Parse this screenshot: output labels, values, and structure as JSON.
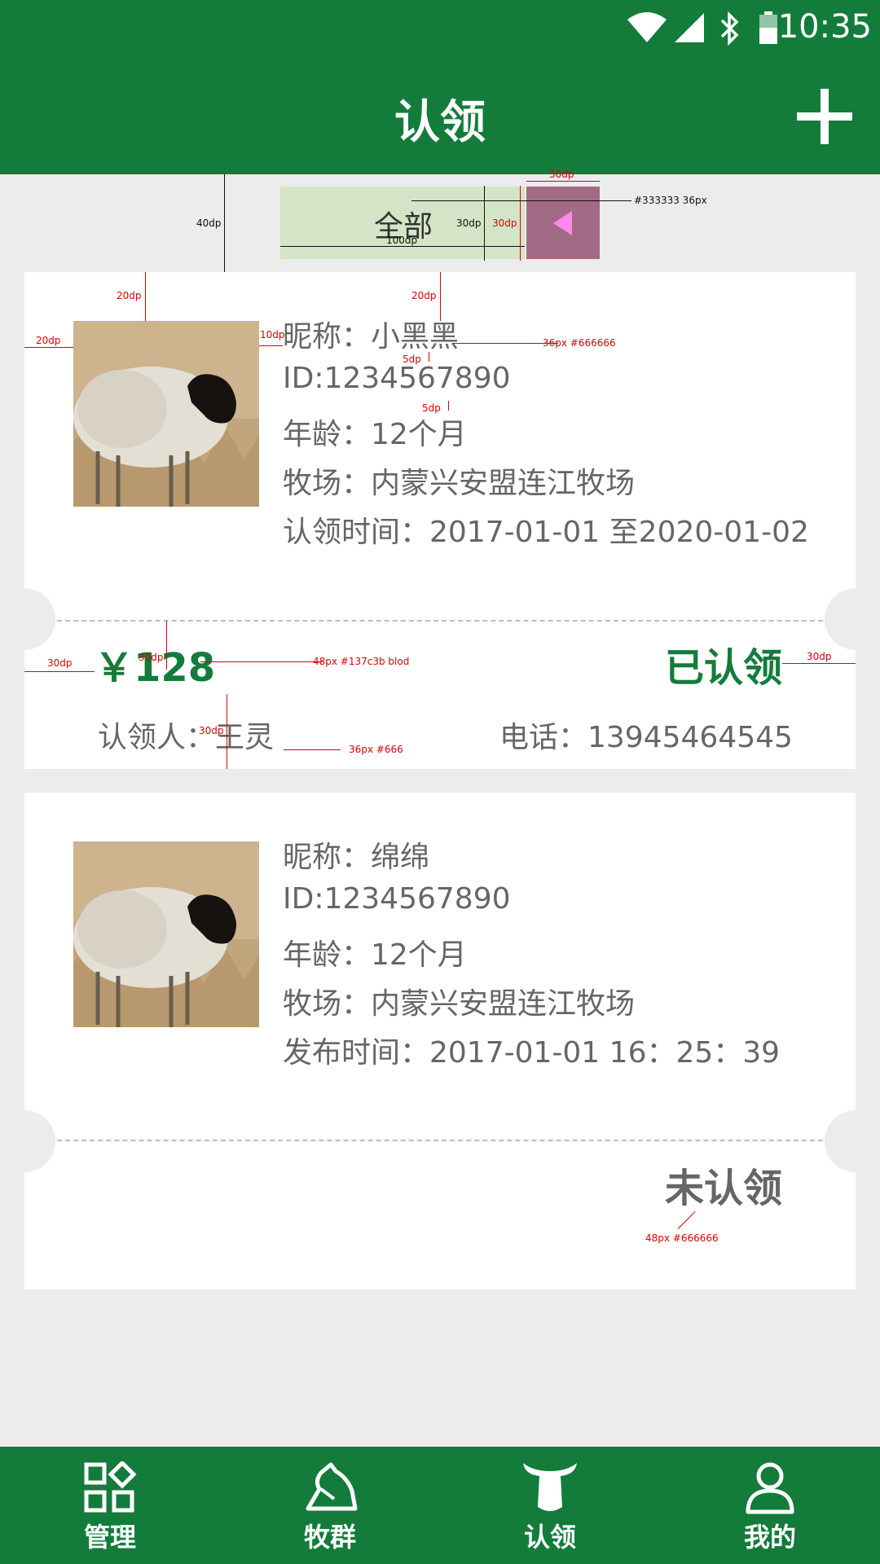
{
  "status_bar": {
    "time": "10:35"
  },
  "header": {
    "title": "认领",
    "add_label": "+"
  },
  "filter": {
    "label": "全部"
  },
  "annotations": {
    "filter_color": "#333333 36px",
    "info_style": "36px #666666",
    "price_style": "48px #137c3b blod",
    "claimant_style": "36px #666",
    "state_style": "48px #666666",
    "d40": "40dp",
    "d100": "100dp",
    "d30": "30dp",
    "d20": "20dp",
    "d10": "10dp",
    "d5": "5dp"
  },
  "cards": [
    {
      "nickname": "昵称：小黑黑",
      "id_line": "ID:1234567890",
      "age": "年龄：12个月",
      "ranch": "牧场：内蒙兴安盟连江牧场",
      "time": "认领时间：2017-01-01 至2020-01-02",
      "price": "￥128",
      "status": "已认领",
      "claimant": "认领人：王灵",
      "phone": "电话：13945464545"
    },
    {
      "nickname": "昵称：绵绵",
      "id_line": "ID:1234567890",
      "age": "年龄：12个月",
      "ranch": "牧场：内蒙兴安盟连江牧场",
      "time": "发布时间：2017-01-01 16：25：39",
      "status": "未认领"
    }
  ],
  "bottom_nav": [
    {
      "label": "管理",
      "icon": "grid-diamond-icon"
    },
    {
      "label": "牧群",
      "icon": "horse-head-icon"
    },
    {
      "label": "认领",
      "icon": "cow-head-icon"
    },
    {
      "label": "我的",
      "icon": "user-icon"
    }
  ],
  "colors": {
    "brand": "#137c3b",
    "filter_bg": "#d3e5c6",
    "arrow_bg": "#a36a85",
    "arrow": "#ff88ee"
  }
}
